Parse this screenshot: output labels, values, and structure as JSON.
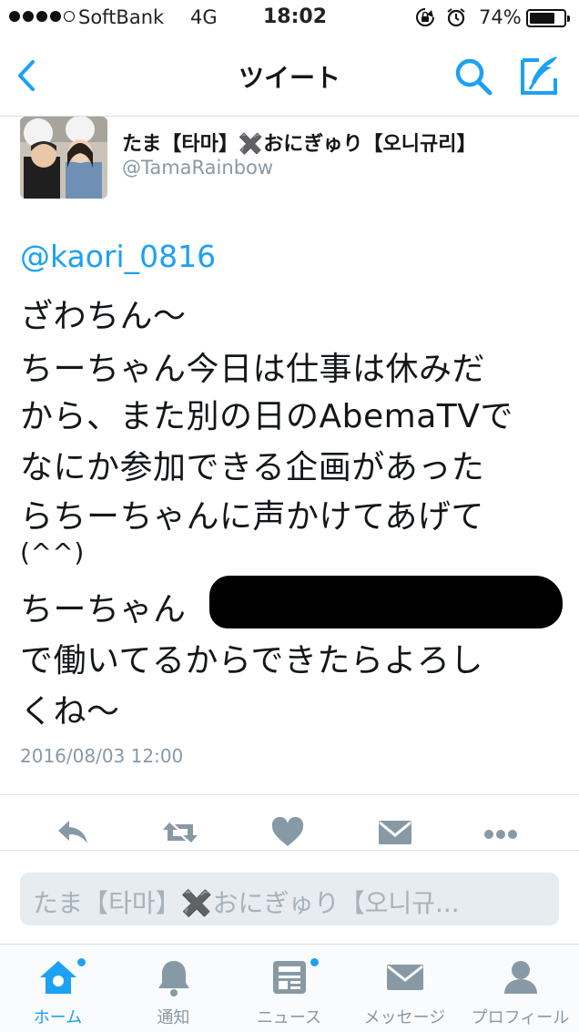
{
  "status": {
    "carrier": "SoftBank",
    "network": "4G",
    "time": "18:02",
    "battery_percent": "74%",
    "battery_level": 0.74,
    "icons": [
      "signal-dots",
      "rotation-lock-icon",
      "alarm-icon",
      "battery-icon"
    ]
  },
  "nav": {
    "title": "ツイート",
    "icons": [
      "back-chevron-icon",
      "search-icon",
      "compose-icon"
    ]
  },
  "tweet": {
    "author_name": "たま【타마】✖️おにぎゅり【오니규리】",
    "author_handle": "@TamaRainbow",
    "mention": "@kaori_0816",
    "lines": [
      "ざわちん〜",
      "ちーちゃん今日は仕事は休みだ",
      "から、また別の日のAbemaTVで",
      "なにか参加できる企画があった",
      "らちーちゃんに声かけてあげて",
      "(^^)",
      "ちーちゃん",
      "で働いてるからできたらよろし",
      "くね〜"
    ],
    "timestamp": "2016/08/03 12:00"
  },
  "actions": {
    "icons": [
      "reply-icon",
      "retweet-icon",
      "like-icon",
      "direct-message-icon",
      "more-icon"
    ]
  },
  "reply_box": {
    "placeholder": "たま【타마】✖️おにぎゅり【오니규..."
  },
  "tabbar": {
    "tabs": [
      {
        "label": "ホーム",
        "icon": "home-icon",
        "active": true,
        "badge": true
      },
      {
        "label": "通知",
        "icon": "bell-icon",
        "active": false,
        "badge": false
      },
      {
        "label": "ニュース",
        "icon": "news-icon",
        "active": false,
        "badge": true
      },
      {
        "label": "メッセージ",
        "icon": "envelope-icon",
        "active": false,
        "badge": false
      },
      {
        "label": "プロフィール",
        "icon": "profile-icon",
        "active": false,
        "badge": false
      }
    ]
  },
  "colors": {
    "accent": "#1da1f2",
    "icon_gray": "#8899a6",
    "text": "#14171a"
  }
}
